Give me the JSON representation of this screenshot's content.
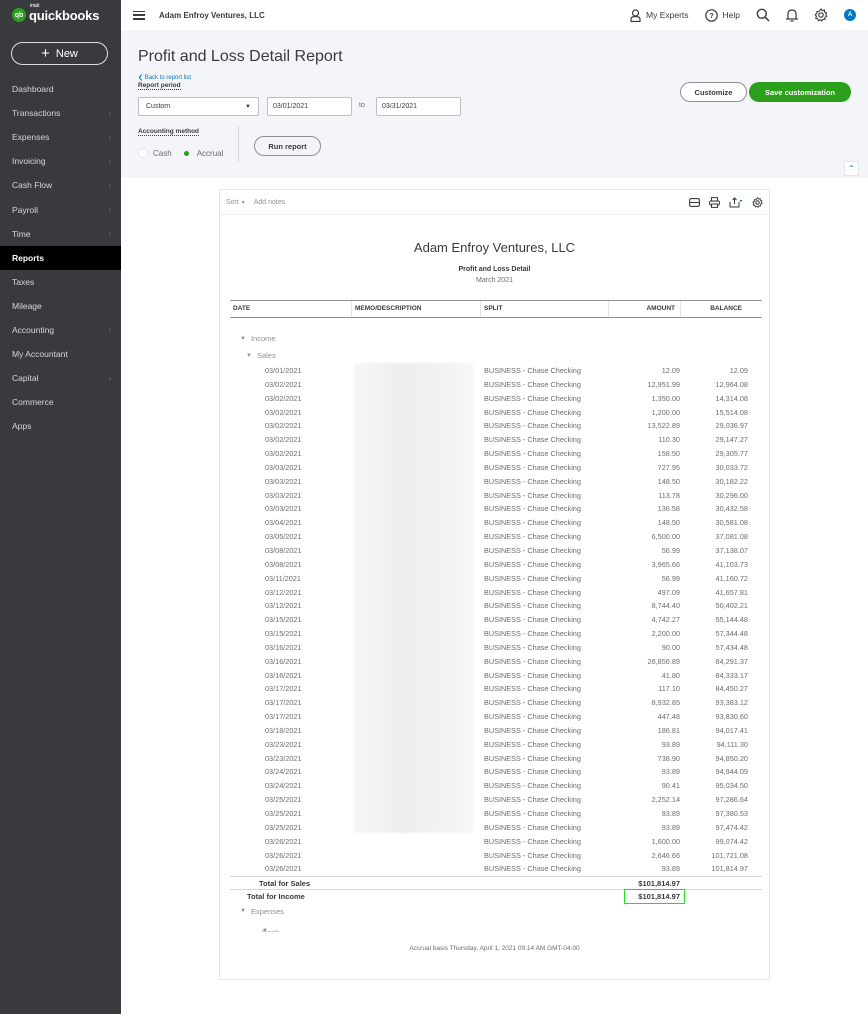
{
  "app": {
    "logo_brand": "quickbooks",
    "logo_sup": "intuit",
    "logo_badge": "qb"
  },
  "sidebar": {
    "new_label": "New",
    "items": [
      {
        "label": "Dashboard",
        "chevron": false,
        "active": false
      },
      {
        "label": "Transactions",
        "chevron": true,
        "active": false
      },
      {
        "label": "Expenses",
        "chevron": true,
        "active": false
      },
      {
        "label": "Invoicing",
        "chevron": true,
        "active": false
      },
      {
        "label": "Cash Flow",
        "chevron": true,
        "active": false
      },
      {
        "label": "Payroll",
        "chevron": true,
        "active": false
      },
      {
        "label": "Time",
        "chevron": true,
        "active": false
      },
      {
        "label": "Reports",
        "chevron": false,
        "active": true
      },
      {
        "label": "Taxes",
        "chevron": false,
        "active": false
      },
      {
        "label": "Mileage",
        "chevron": false,
        "active": false
      },
      {
        "label": "Accounting",
        "chevron": true,
        "active": false
      },
      {
        "label": "My Accountant",
        "chevron": false,
        "active": false
      },
      {
        "label": "Capital",
        "chevron": true,
        "active": false
      },
      {
        "label": "Commerce",
        "chevron": false,
        "active": false
      },
      {
        "label": "Apps",
        "chevron": false,
        "active": false
      }
    ]
  },
  "topbar": {
    "company": "Adam Enfroy Ventures, LLC",
    "my_experts": "My Experts",
    "help": "Help",
    "avatar_initial": "A",
    "icons": [
      "menu-icon",
      "experts-icon",
      "help-icon",
      "search-icon",
      "bell-icon",
      "gear-icon"
    ]
  },
  "header": {
    "title": "Profit and Loss Detail Report",
    "back_link": "Back to report list",
    "report_period_label": "Report period",
    "period_value": "Custom",
    "date_from": "03/01/2021",
    "to_label": "to",
    "date_to": "03/31/2021",
    "accounting_method_label": "Accounting method",
    "method_options": [
      "Cash",
      "Accrual"
    ],
    "method_selected": "Accrual",
    "run_report": "Run report",
    "customize": "Customize",
    "save_customization": "Save customization",
    "collapse_glyph": "^"
  },
  "report": {
    "toolbar": {
      "sort": "Sort",
      "add_notes": "Add notes"
    },
    "company": "Adam Enfroy Ventures, LLC",
    "name": "Profit and Loss Detail",
    "period": "March 2021",
    "columns": [
      "DATE",
      "MEMO/DESCRIPTION",
      "SPLIT",
      "AMOUNT",
      "BALANCE"
    ],
    "group_income": "Income",
    "group_sales": "Sales",
    "rows": [
      {
        "date": "03/01/2021",
        "split": "BUSINESS - Chase Checking",
        "amount": "12.09",
        "balance": "12.09"
      },
      {
        "date": "03/02/2021",
        "split": "BUSINESS - Chase Checking",
        "amount": "12,951.99",
        "balance": "12,964.08"
      },
      {
        "date": "03/02/2021",
        "split": "BUSINESS - Chase Checking",
        "amount": "1,350.00",
        "balance": "14,314.08"
      },
      {
        "date": "03/02/2021",
        "split": "BUSINESS - Chase Checking",
        "amount": "1,200.00",
        "balance": "15,514.08"
      },
      {
        "date": "03/02/2021",
        "split": "BUSINESS - Chase Checking",
        "amount": "13,522.89",
        "balance": "29,036.97"
      },
      {
        "date": "03/02/2021",
        "split": "BUSINESS - Chase Checking",
        "amount": "110.30",
        "balance": "29,147.27"
      },
      {
        "date": "03/02/2021",
        "split": "BUSINESS - Chase Checking",
        "amount": "158.50",
        "balance": "29,305.77"
      },
      {
        "date": "03/03/2021",
        "split": "BUSINESS - Chase Checking",
        "amount": "727.95",
        "balance": "30,033.72"
      },
      {
        "date": "03/03/2021",
        "split": "BUSINESS - Chase Checking",
        "amount": "148.50",
        "balance": "30,182.22"
      },
      {
        "date": "03/03/2021",
        "split": "BUSINESS - Chase Checking",
        "amount": "113.78",
        "balance": "30,296.00"
      },
      {
        "date": "03/03/2021",
        "split": "BUSINESS - Chase Checking",
        "amount": "136.58",
        "balance": "30,432.58"
      },
      {
        "date": "03/04/2021",
        "split": "BUSINESS - Chase Checking",
        "amount": "148.50",
        "balance": "30,581.08"
      },
      {
        "date": "03/05/2021",
        "split": "BUSINESS - Chase Checking",
        "amount": "6,500.00",
        "balance": "37,081.08"
      },
      {
        "date": "03/08/2021",
        "split": "BUSINESS - Chase Checking",
        "amount": "56.99",
        "balance": "37,138.07"
      },
      {
        "date": "03/08/2021",
        "split": "BUSINESS - Chase Checking",
        "amount": "3,965.66",
        "balance": "41,103.73"
      },
      {
        "date": "03/11/2021",
        "split": "BUSINESS - Chase Checking",
        "amount": "56.99",
        "balance": "41,160.72"
      },
      {
        "date": "03/12/2021",
        "split": "BUSINESS - Chase Checking",
        "amount": "497.09",
        "balance": "41,657.81"
      },
      {
        "date": "03/12/2021",
        "split": "BUSINESS - Chase Checking",
        "amount": "8,744.40",
        "balance": "50,402.21"
      },
      {
        "date": "03/15/2021",
        "split": "BUSINESS - Chase Checking",
        "amount": "4,742.27",
        "balance": "55,144.48"
      },
      {
        "date": "03/15/2021",
        "split": "BUSINESS - Chase Checking",
        "amount": "2,200.00",
        "balance": "57,344.48"
      },
      {
        "date": "03/16/2021",
        "split": "BUSINESS - Chase Checking",
        "amount": "90.00",
        "balance": "57,434.48"
      },
      {
        "date": "03/16/2021",
        "split": "BUSINESS - Chase Checking",
        "amount": "26,856.89",
        "balance": "84,291.37"
      },
      {
        "date": "03/16/2021",
        "split": "BUSINESS - Chase Checking",
        "amount": "41.80",
        "balance": "84,333.17"
      },
      {
        "date": "03/17/2021",
        "split": "BUSINESS - Chase Checking",
        "amount": "117.10",
        "balance": "84,450.27"
      },
      {
        "date": "03/17/2021",
        "split": "BUSINESS - Chase Checking",
        "amount": "8,932.85",
        "balance": "93,383.12"
      },
      {
        "date": "03/17/2021",
        "split": "BUSINESS - Chase Checking",
        "amount": "447.48",
        "balance": "93,830.60"
      },
      {
        "date": "03/18/2021",
        "split": "BUSINESS - Chase Checking",
        "amount": "186.81",
        "balance": "94,017.41"
      },
      {
        "date": "03/23/2021",
        "split": "BUSINESS - Chase Checking",
        "amount": "93.89",
        "balance": "94,111.30"
      },
      {
        "date": "03/23/2021",
        "split": "BUSINESS - Chase Checking",
        "amount": "738.90",
        "balance": "94,850.20"
      },
      {
        "date": "03/24/2021",
        "split": "BUSINESS - Chase Checking",
        "amount": "93.89",
        "balance": "94,944.09"
      },
      {
        "date": "03/24/2021",
        "split": "BUSINESS - Chase Checking",
        "amount": "90.41",
        "balance": "95,034.50"
      },
      {
        "date": "03/25/2021",
        "split": "BUSINESS - Chase Checking",
        "amount": "2,252.14",
        "balance": "97,286.64"
      },
      {
        "date": "03/25/2021",
        "split": "BUSINESS - Chase Checking",
        "amount": "93.89",
        "balance": "97,380.53"
      },
      {
        "date": "03/25/2021",
        "split": "BUSINESS - Chase Checking",
        "amount": "93.89",
        "balance": "97,474.42"
      },
      {
        "date": "03/26/2021",
        "split": "BUSINESS - Chase Checking",
        "amount": "1,600.00",
        "balance": "99,074.42"
      },
      {
        "date": "03/26/2021",
        "split": "BUSINESS - Chase Checking",
        "amount": "2,646.66",
        "balance": "101,721.08"
      },
      {
        "date": "03/26/2021",
        "split": "BUSINESS - Chase Checking",
        "amount": "93.89",
        "balance": "101,814.97"
      }
    ],
    "total_sales_label": "Total for Sales",
    "total_sales_value": "$101,814.97",
    "total_income_label": "Total for Income",
    "total_income_value": "$101,814.97",
    "group_expenses": "Expenses",
    "group_bank_charges": "Bank Charges & Fees",
    "footer": "Accrual basis  Thursday, April 1, 2021  09:14 AM GMT-04:00"
  },
  "colors": {
    "brand_green": "#2ca01c",
    "link_blue": "#0077c5",
    "sidebar_bg": "#393a3d",
    "highlight_box": "#22dd22"
  }
}
